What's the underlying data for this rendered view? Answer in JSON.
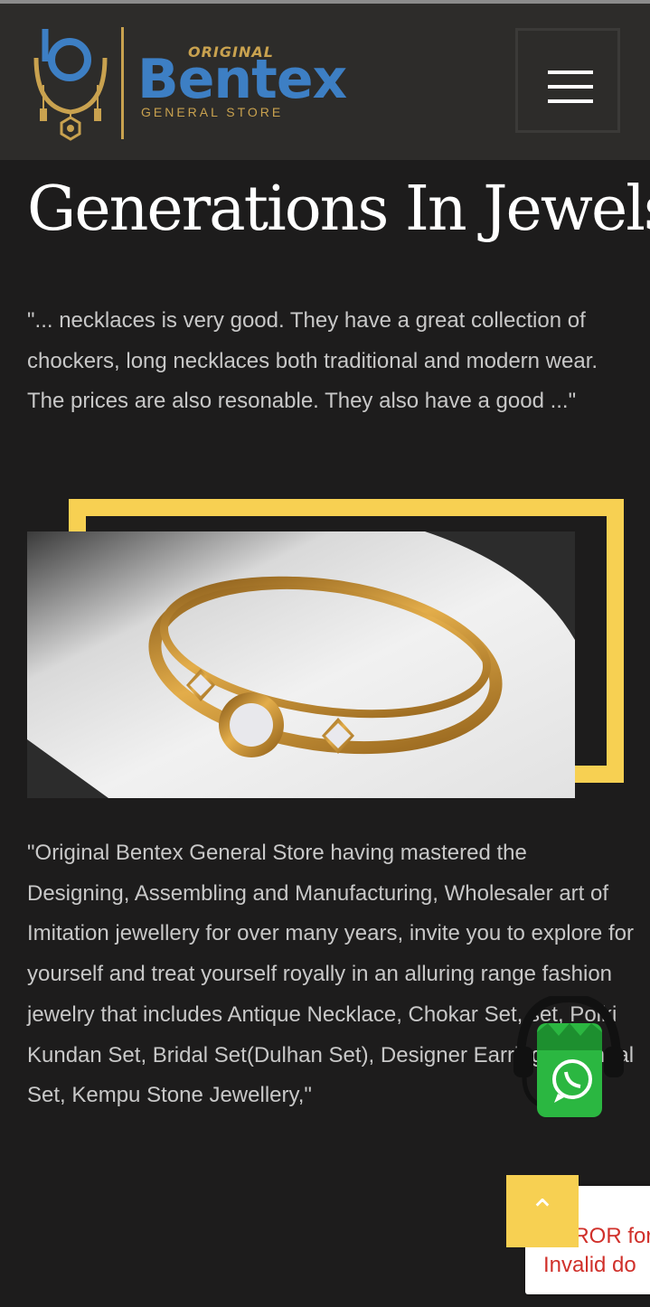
{
  "header": {
    "logo": {
      "small": "ORIGINAL",
      "name": "Bentex",
      "tagline": "GENERAL STORE"
    }
  },
  "main": {
    "heading": "Generations In Jewels",
    "quote": "\"... necklaces is very good. They have a great collection of chockers, long necklaces both traditional and modern wear. The prices are also resonable. They also have a good ...\"",
    "body": "\"Original Bentex General Store having mastered the Designing, Assembling and Manufacturing, Wholesaler art of Imitation jewellery for over many years, invite you to explore for yourself and treat yourself royally in an alluring range fashion jewelry that includes Antique Necklace, Chokar Set, set, Polki Kundan Set, Bridal Set(Dulhan Set), Designer Earrings, Pendal Set, Kempu Stone Jewellery,\""
  },
  "recaptcha": {
    "line1": "ERROR for",
    "line2": "Invalid do"
  },
  "colors": {
    "accent": "#f7d052",
    "header_bg": "#2d2c2a",
    "page_bg": "#1d1c1c",
    "whatsapp": "#2bb741"
  },
  "icons": {
    "menu": "hamburger-icon",
    "scroll_top": "double-chevron-up-icon",
    "chat": "whatsapp-icon"
  }
}
